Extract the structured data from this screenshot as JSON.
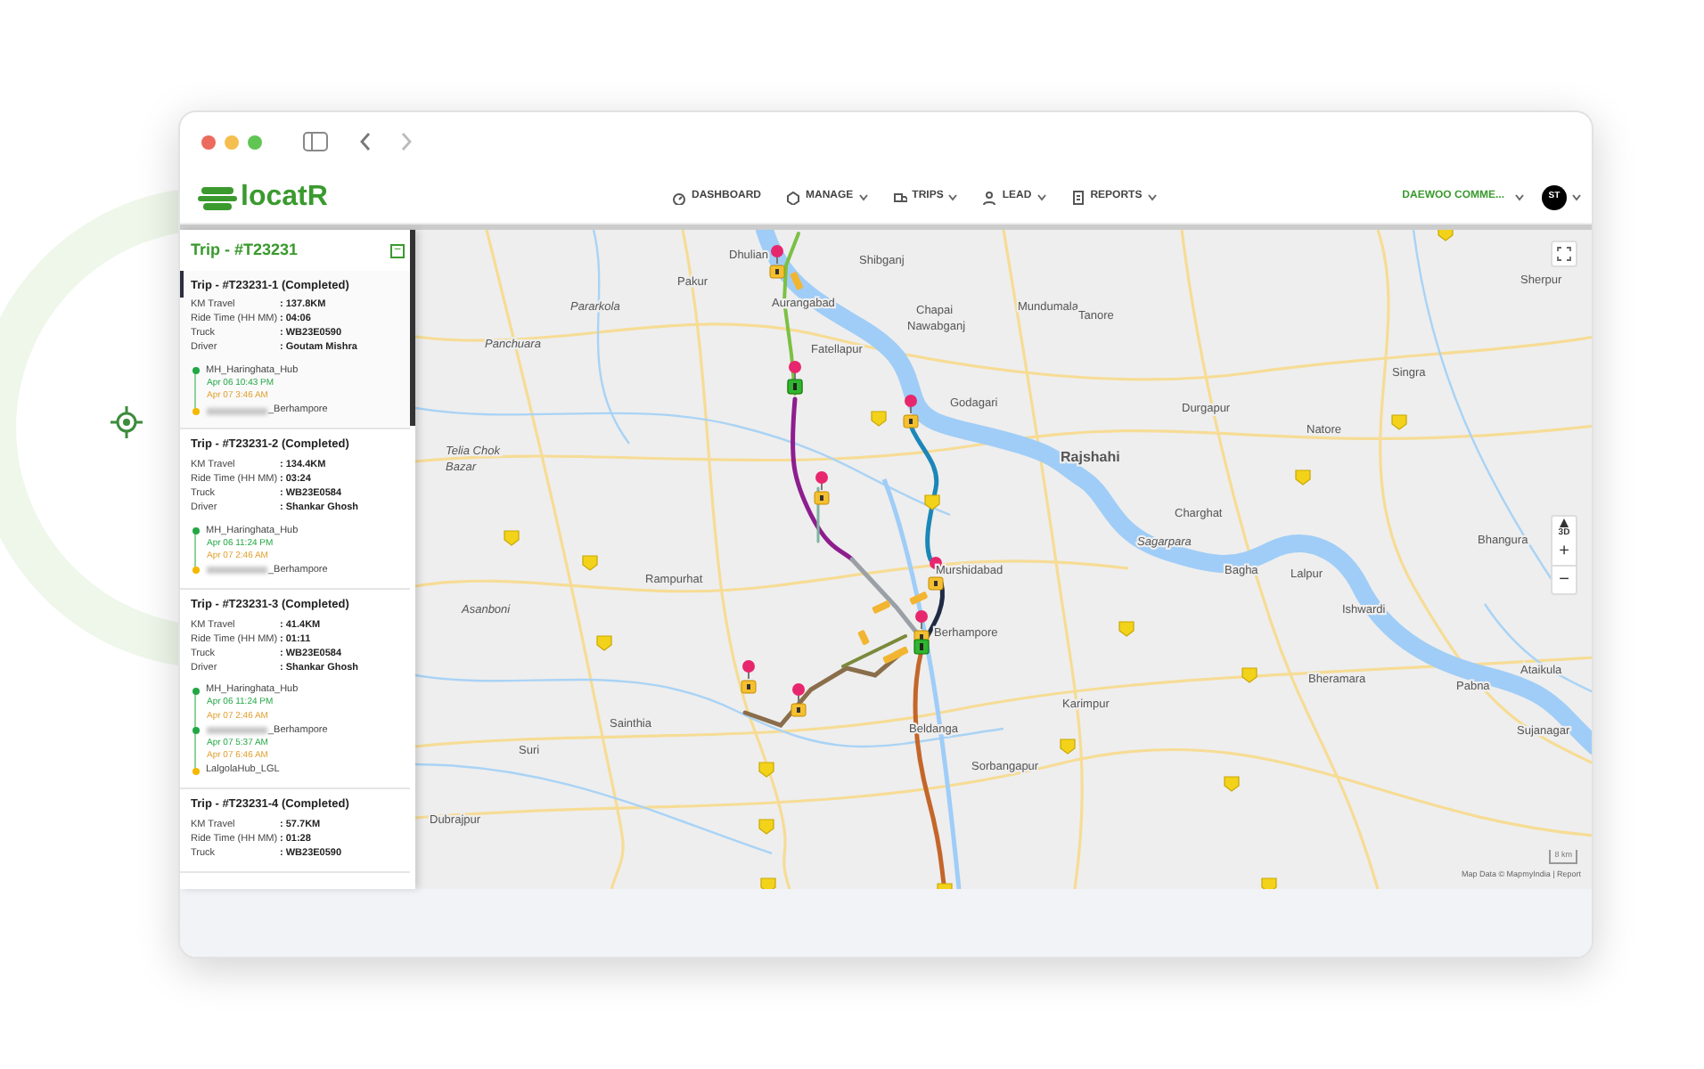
{
  "app": {
    "logo": "locatR"
  },
  "nav": [
    {
      "label": "DASHBOARD",
      "has_menu": false
    },
    {
      "label": "MANAGE",
      "has_menu": true
    },
    {
      "label": "TRIPS",
      "has_menu": true
    },
    {
      "label": "LEAD",
      "has_menu": true
    },
    {
      "label": "REPORTS",
      "has_menu": true
    }
  ],
  "account": {
    "company": "DAEWOO COMME...",
    "avatar": "ST"
  },
  "sidebar": {
    "title": "Trip - #T23231",
    "collapse": "−",
    "trips": [
      {
        "title": "Trip - #T23231-1 (Completed)",
        "selected": true,
        "rows": [
          {
            "label": "KM Travel",
            "value": ": 137.8KM"
          },
          {
            "label": "Ride Time (HH MM)",
            "value": ": 04:06"
          },
          {
            "label": "Truck",
            "value": ": WB23E0590"
          },
          {
            "label": "Driver",
            "value": ": Goutam Mishra"
          }
        ],
        "timeline": [
          {
            "kind": "stop",
            "text": "MH_Haringhata_Hub",
            "color": "#22a745",
            "redacted": false
          },
          {
            "kind": "depart",
            "text": "Apr 06 10:43 PM"
          },
          {
            "kind": "arrive",
            "text": "Apr 07 3:46 AM"
          },
          {
            "kind": "stop",
            "text": "_Berhampore",
            "color": "#f5b800",
            "redacted": true
          }
        ]
      },
      {
        "title": "Trip - #T23231-2 (Completed)",
        "selected": false,
        "rows": [
          {
            "label": "KM Travel",
            "value": ": 134.4KM"
          },
          {
            "label": "Ride Time (HH MM)",
            "value": ": 03:24"
          },
          {
            "label": "Truck",
            "value": ": WB23E0584"
          },
          {
            "label": "Driver",
            "value": ": Shankar Ghosh"
          }
        ],
        "timeline": [
          {
            "kind": "stop",
            "text": "MH_Haringhata_Hub",
            "color": "#22a745",
            "redacted": false
          },
          {
            "kind": "depart",
            "text": "Apr 06 11:24 PM"
          },
          {
            "kind": "arrive",
            "text": "Apr 07 2:46 AM"
          },
          {
            "kind": "stop",
            "text": "_Berhampore",
            "color": "#f5b800",
            "redacted": true
          }
        ]
      },
      {
        "title": "Trip - #T23231-3 (Completed)",
        "selected": false,
        "rows": [
          {
            "label": "KM Travel",
            "value": ": 41.4KM"
          },
          {
            "label": "Ride Time (HH MM)",
            "value": ": 01:11"
          },
          {
            "label": "Truck",
            "value": ": WB23E0584"
          },
          {
            "label": "Driver",
            "value": ": Shankar Ghosh"
          }
        ],
        "timeline": [
          {
            "kind": "stop",
            "text": "MH_Haringhata_Hub",
            "color": "#22a745",
            "redacted": false
          },
          {
            "kind": "depart",
            "text": "Apr 06 11:24 PM"
          },
          {
            "kind": "arrive",
            "text": "Apr 07 2:46 AM"
          },
          {
            "kind": "stop",
            "text": "_Berhampore",
            "color": "#22a745",
            "redacted": true
          },
          {
            "kind": "depart",
            "text": "Apr 07 5:37 AM"
          },
          {
            "kind": "arrive",
            "text": "Apr 07 6:46 AM"
          },
          {
            "kind": "stop",
            "text": "LalgolaHub_LGL",
            "color": "#f5b800",
            "redacted": false
          }
        ]
      },
      {
        "title": "Trip - #T23231-4 (Completed)",
        "selected": false,
        "rows": [
          {
            "label": "KM Travel",
            "value": ": 57.7KM"
          },
          {
            "label": "Ride Time (HH MM)",
            "value": ": 01:28"
          },
          {
            "label": "Truck",
            "value": ": WB23E0590"
          }
        ]
      }
    ]
  },
  "map": {
    "places": [
      "Dhulian",
      "Shibganj",
      "Pakur",
      "Pararkola",
      "Aurangabad",
      "Chapai",
      "Nawabganj",
      "Panchuara",
      "Fatellapur",
      "Godagari",
      "Telia Chok",
      "Bazar",
      "Rampurhat",
      "Asanboni",
      "Murshidabad",
      "Berhampore",
      "Sainthia",
      "Suri",
      "Dubrajpur",
      "Beldanga",
      "Sorbangapur",
      "Mundumala",
      "Tanore",
      "Durgapur",
      "Singra",
      "Natore",
      "Rajshahi",
      "Charghat",
      "Sagarpara",
      "Bagha",
      "Lalpur",
      "Ishwardi",
      "Bheramara",
      "Karimpur",
      "Pabna",
      "Ataikula",
      "Sujanagar",
      "Bhangura",
      "Sherpur"
    ],
    "controls": {
      "view_3d": "3D",
      "zoom_in": "+",
      "zoom_out": "−"
    },
    "scale": "8 km",
    "attribution": "Map Data © MapmyIndia | Report"
  }
}
